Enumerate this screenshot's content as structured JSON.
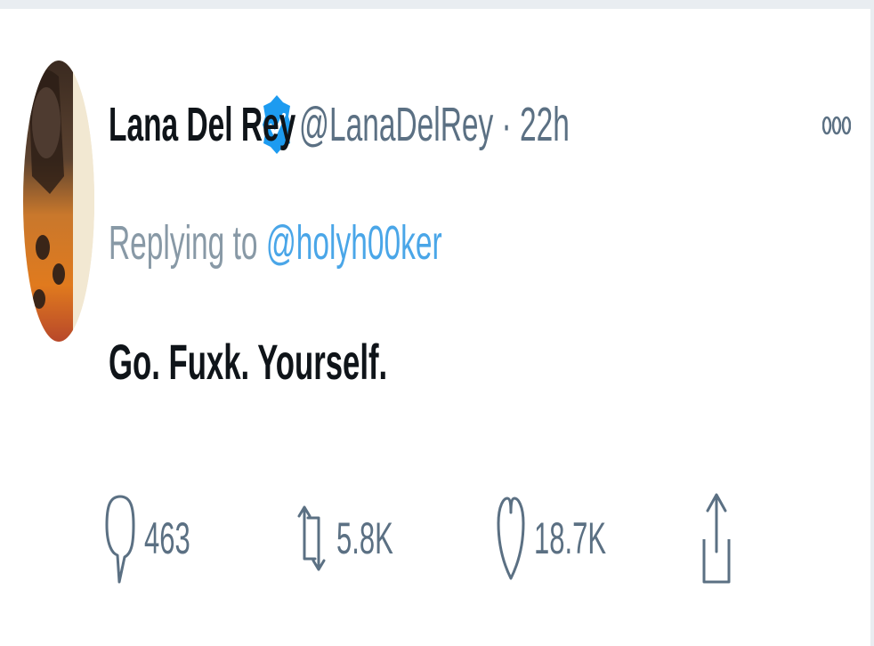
{
  "tweet": {
    "display_name": "Lana Del Rey",
    "handle": "@LanaDelRey",
    "separator": "·",
    "time": "22h",
    "replying_label": "Replying to",
    "replying_to": "@holyh00ker",
    "text": "Go. Fuxk. Yourself."
  },
  "actions": {
    "replies": "463",
    "retweets": "5.8K",
    "likes": "18.7K"
  },
  "icons": {
    "verified": "verified-badge-icon",
    "more": "more-options-icon",
    "reply": "reply-icon",
    "retweet": "retweet-icon",
    "like": "heart-icon",
    "share": "share-icon"
  },
  "colors": {
    "name": "#0f1419",
    "secondary": "#5b7083",
    "link": "#4aa6e8",
    "verified": "#1d9bf0"
  }
}
